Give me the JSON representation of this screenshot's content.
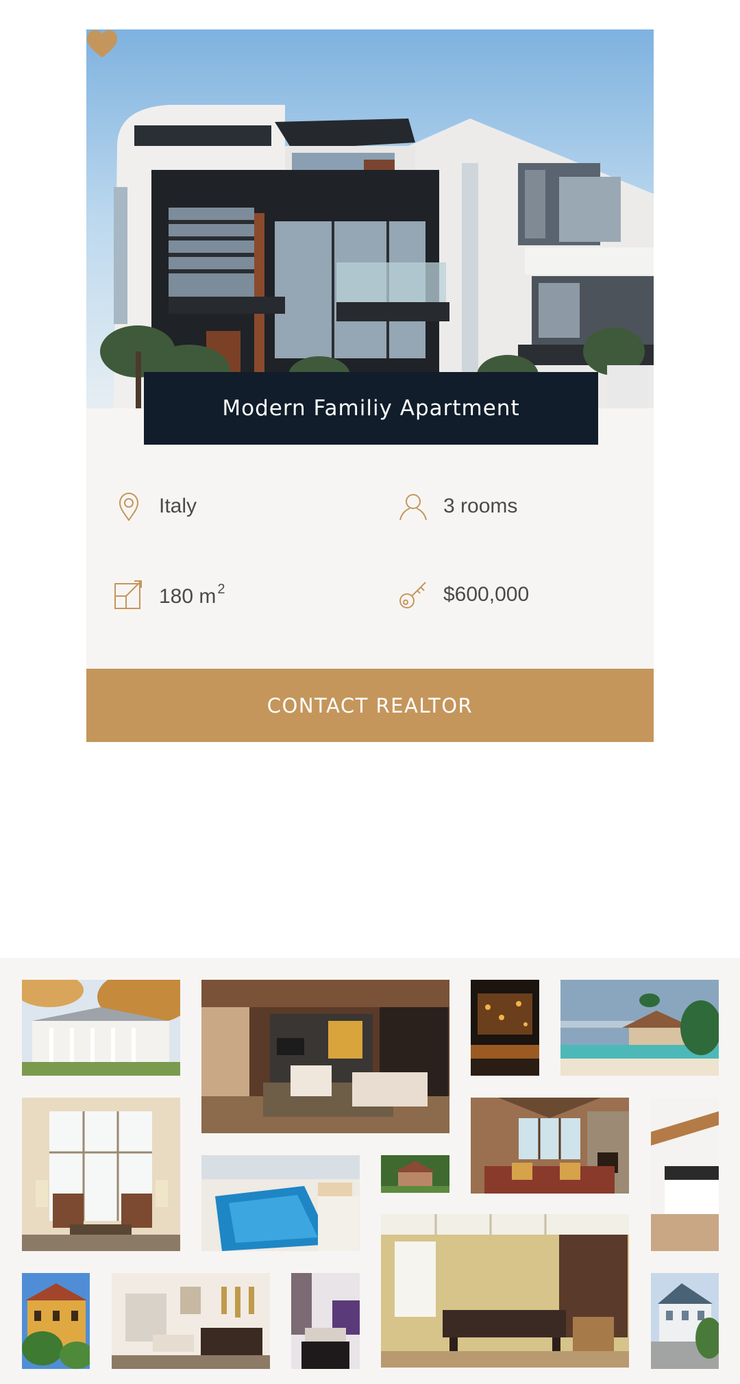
{
  "listing": {
    "title": "Modern Familiy Apartment",
    "location": "Italy",
    "rooms": "3 rooms",
    "area_value": "180 m",
    "area_sup": "2",
    "price": "$600,000",
    "cta_label": "CONTACT REALTOR",
    "favorite": true
  },
  "icons": {
    "favorite": "heart-icon",
    "location": "map-pin-icon",
    "rooms": "user-icon",
    "area": "area-icon",
    "price": "key-icon"
  },
  "colors": {
    "accent": "#c4965c",
    "title_band": "#111d2b",
    "panel": "#f7f5f3",
    "text": "#4a4a4a"
  },
  "gallery": {
    "photos": [
      "white-mansion-autumn",
      "living-room-wood-floor",
      "bar-interior-night",
      "beach-hut-sea",
      "sitting-room-armchairs",
      "indoor-pool",
      "wooden-house-small",
      "lodge-living-room",
      "kitchen-white",
      "billiard-room",
      "yellow-villa",
      "dining-living-room",
      "purple-living-room",
      "white-house-street"
    ]
  }
}
